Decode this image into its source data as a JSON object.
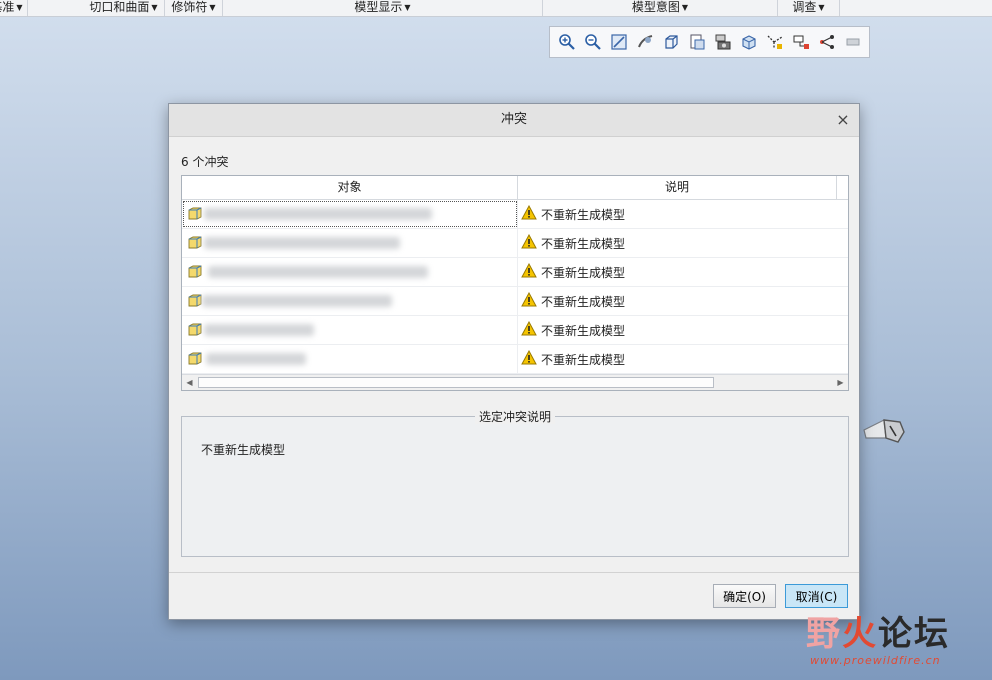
{
  "ribbon": {
    "items": [
      {
        "label": "基准"
      },
      {
        "label": "切口和曲面"
      },
      {
        "label": "修饰符"
      },
      {
        "label": "模型显示"
      },
      {
        "label": "模型意图"
      },
      {
        "label": "调查"
      }
    ]
  },
  "graphics_toolbar": {
    "icons": [
      "zoom-in-icon",
      "zoom-out-icon",
      "refit-icon",
      "orient-icon",
      "saved-views-icon",
      "display-style-icon",
      "perspective-icon",
      "spin-center-icon",
      "datum-display-icon",
      "annotation-display-icon",
      "feature-display-icon",
      "more-icon"
    ]
  },
  "dialog": {
    "title": "冲突",
    "close_symbol": "×",
    "count_label": "6 个冲突",
    "columns": {
      "object": "对象",
      "description": "说明"
    },
    "rows": [
      {
        "description": "不重新生成模型",
        "selected": true
      },
      {
        "description": "不重新生成模型",
        "selected": false
      },
      {
        "description": "不重新生成模型",
        "selected": false
      },
      {
        "description": "不重新生成模型",
        "selected": false
      },
      {
        "description": "不重新生成模型",
        "selected": false
      },
      {
        "description": "不重新生成模型",
        "selected": false
      }
    ],
    "detail_group_title": "选定冲突说明",
    "detail_text": "不重新生成模型",
    "ok_label": "确定(O)",
    "cancel_label": "取消(C)"
  },
  "watermark": {
    "text_part1": "野",
    "text_part2": "火",
    "text_part3": "论坛",
    "url": "www.proewildfire.cn"
  },
  "colors": {
    "accent_selected_button": "#c9e6f7",
    "warning_yellow": "#f5c400",
    "watermark_red": "#e24a33"
  }
}
